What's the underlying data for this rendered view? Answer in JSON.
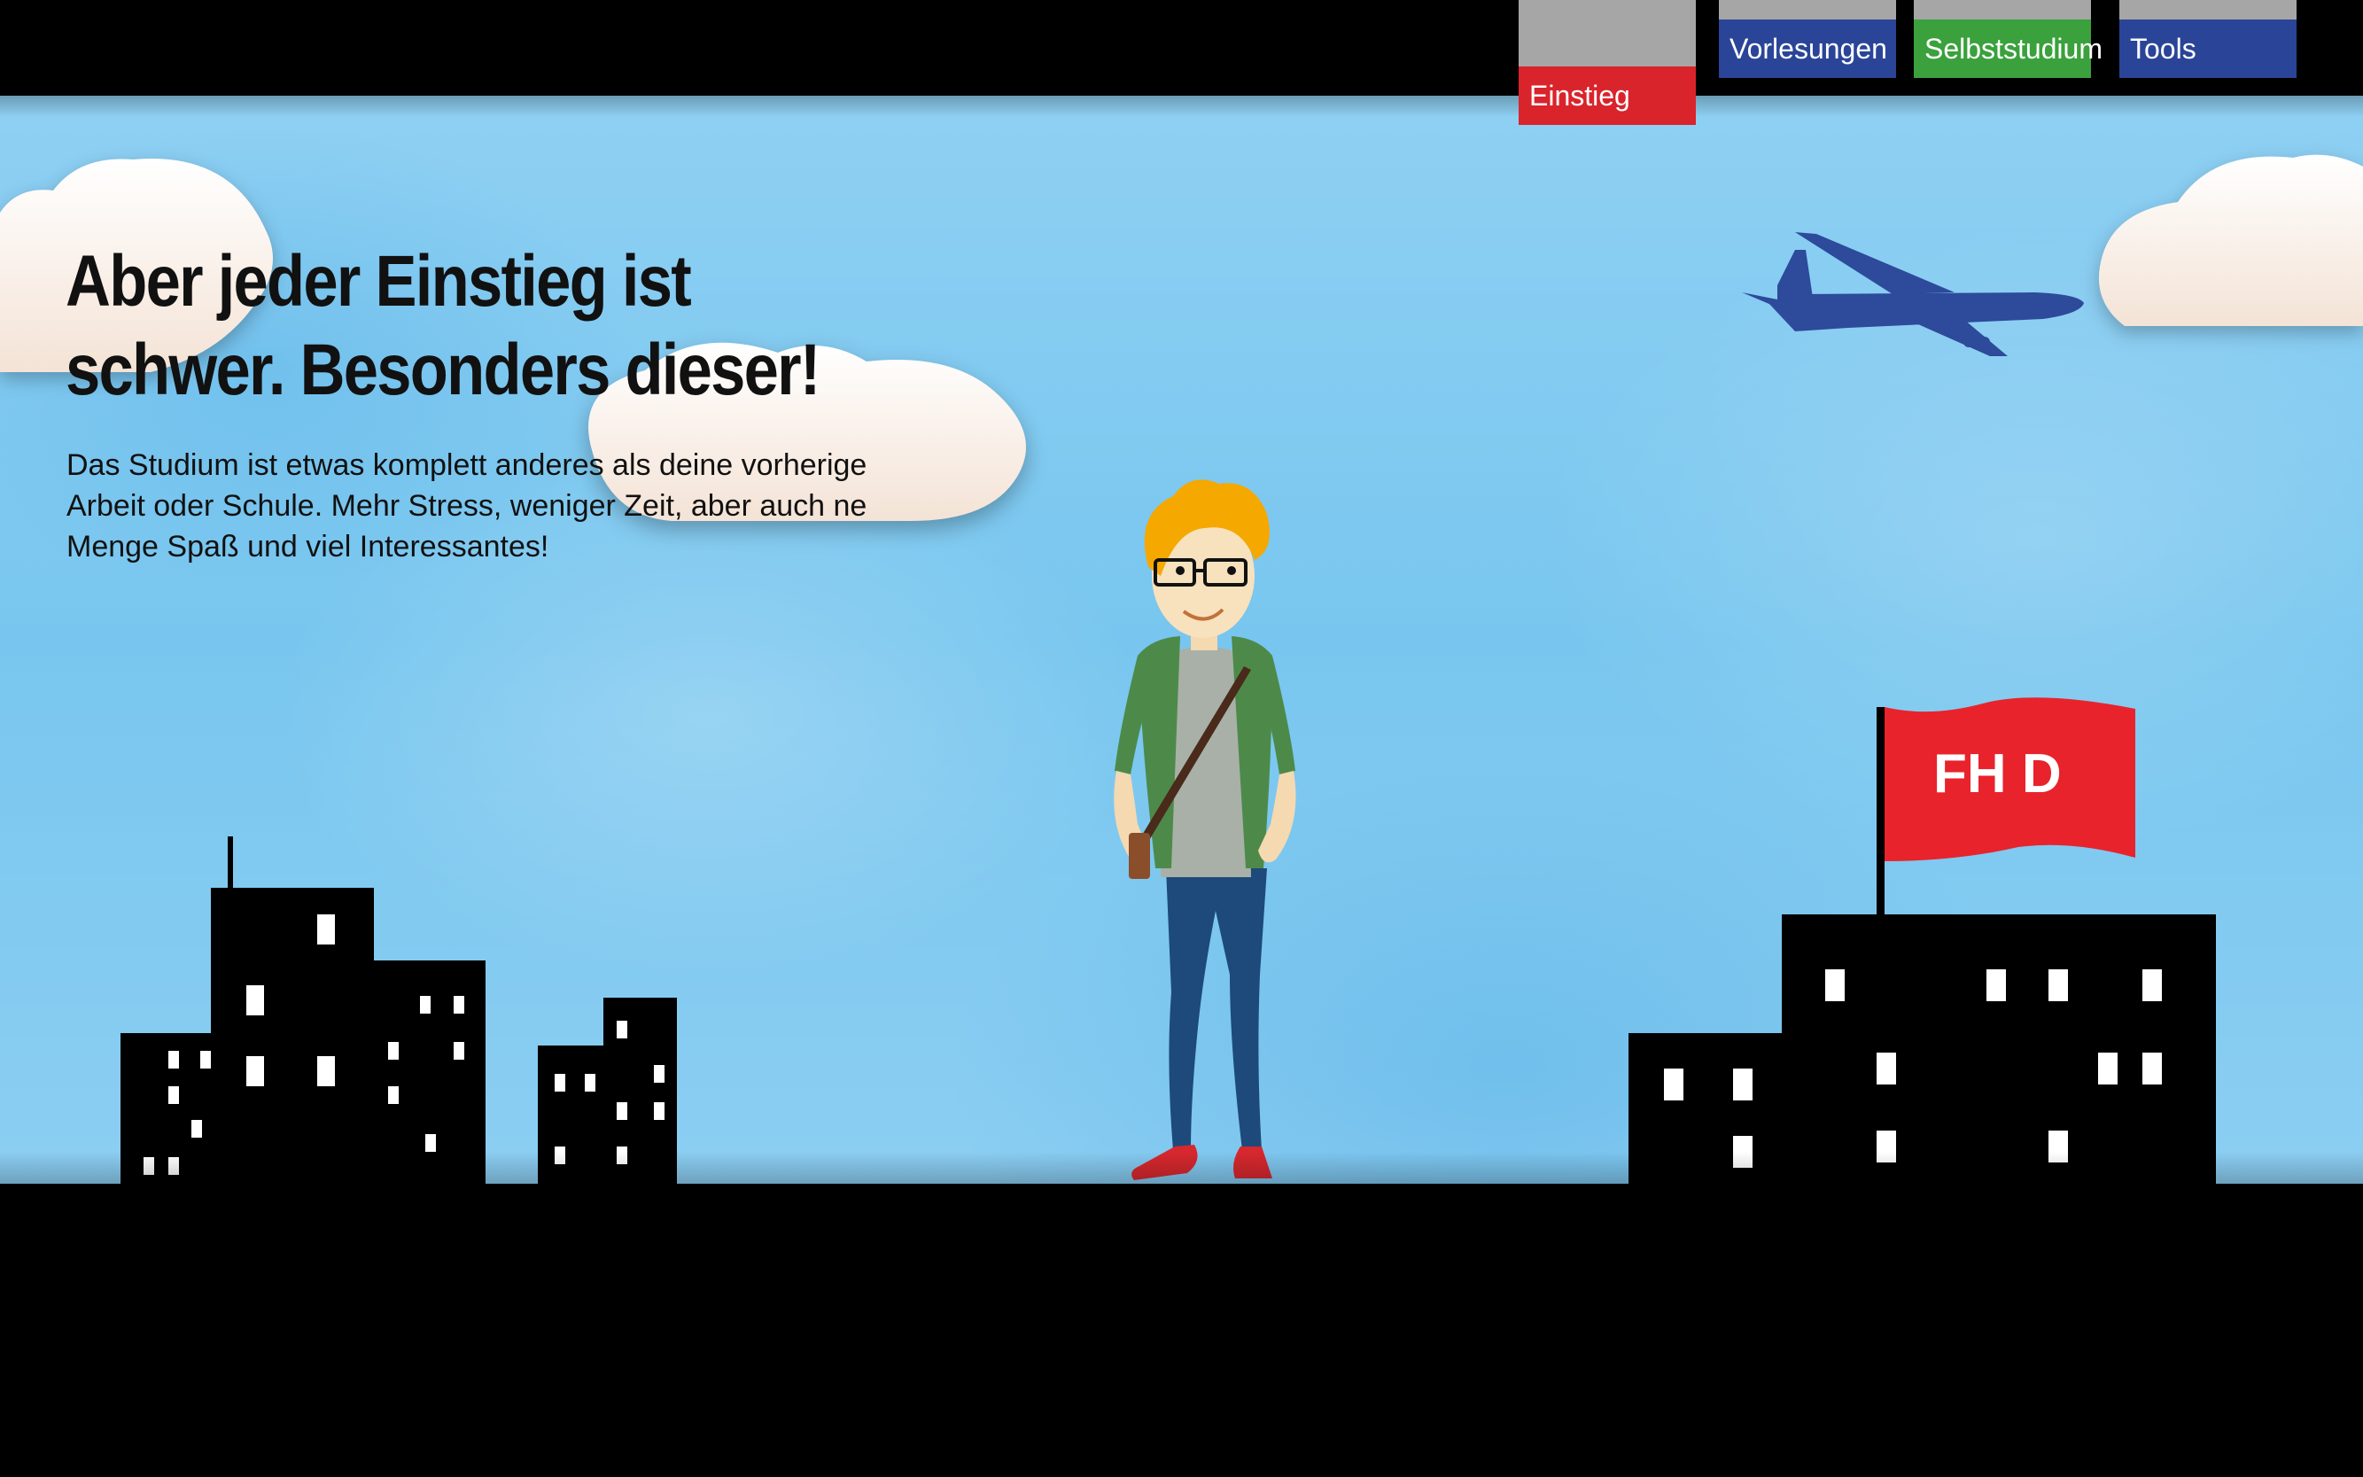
{
  "nav": {
    "items": [
      {
        "label": "Einstieg",
        "color": "#d9242c",
        "active": true
      },
      {
        "label": "Vorlesungen",
        "color": "#2a4598",
        "active": false
      },
      {
        "label": "Selbststudium",
        "color": "#3aa13c",
        "active": false
      },
      {
        "label": "Tools",
        "color": "#2a4598",
        "active": false
      }
    ]
  },
  "hero": {
    "headline_line1": "Aber jeder Einstieg ist",
    "headline_line2": "schwer. Besonders dieser!",
    "body": "Das Studium ist etwas komplett anderes als deine vorherige Arbeit oder Schule. Mehr Stress, weniger Zeit, aber auch ne Menge Spaß und viel Interessantes!"
  },
  "scene": {
    "flag_text": "FH D",
    "flag_color": "#e8232c",
    "plane_color": "#2d4a9b",
    "sky_color": "#80c9f0",
    "icons": [
      "cloud-icon",
      "airplane-icon",
      "student-character",
      "city-skyline",
      "university-building",
      "flag-icon"
    ]
  }
}
